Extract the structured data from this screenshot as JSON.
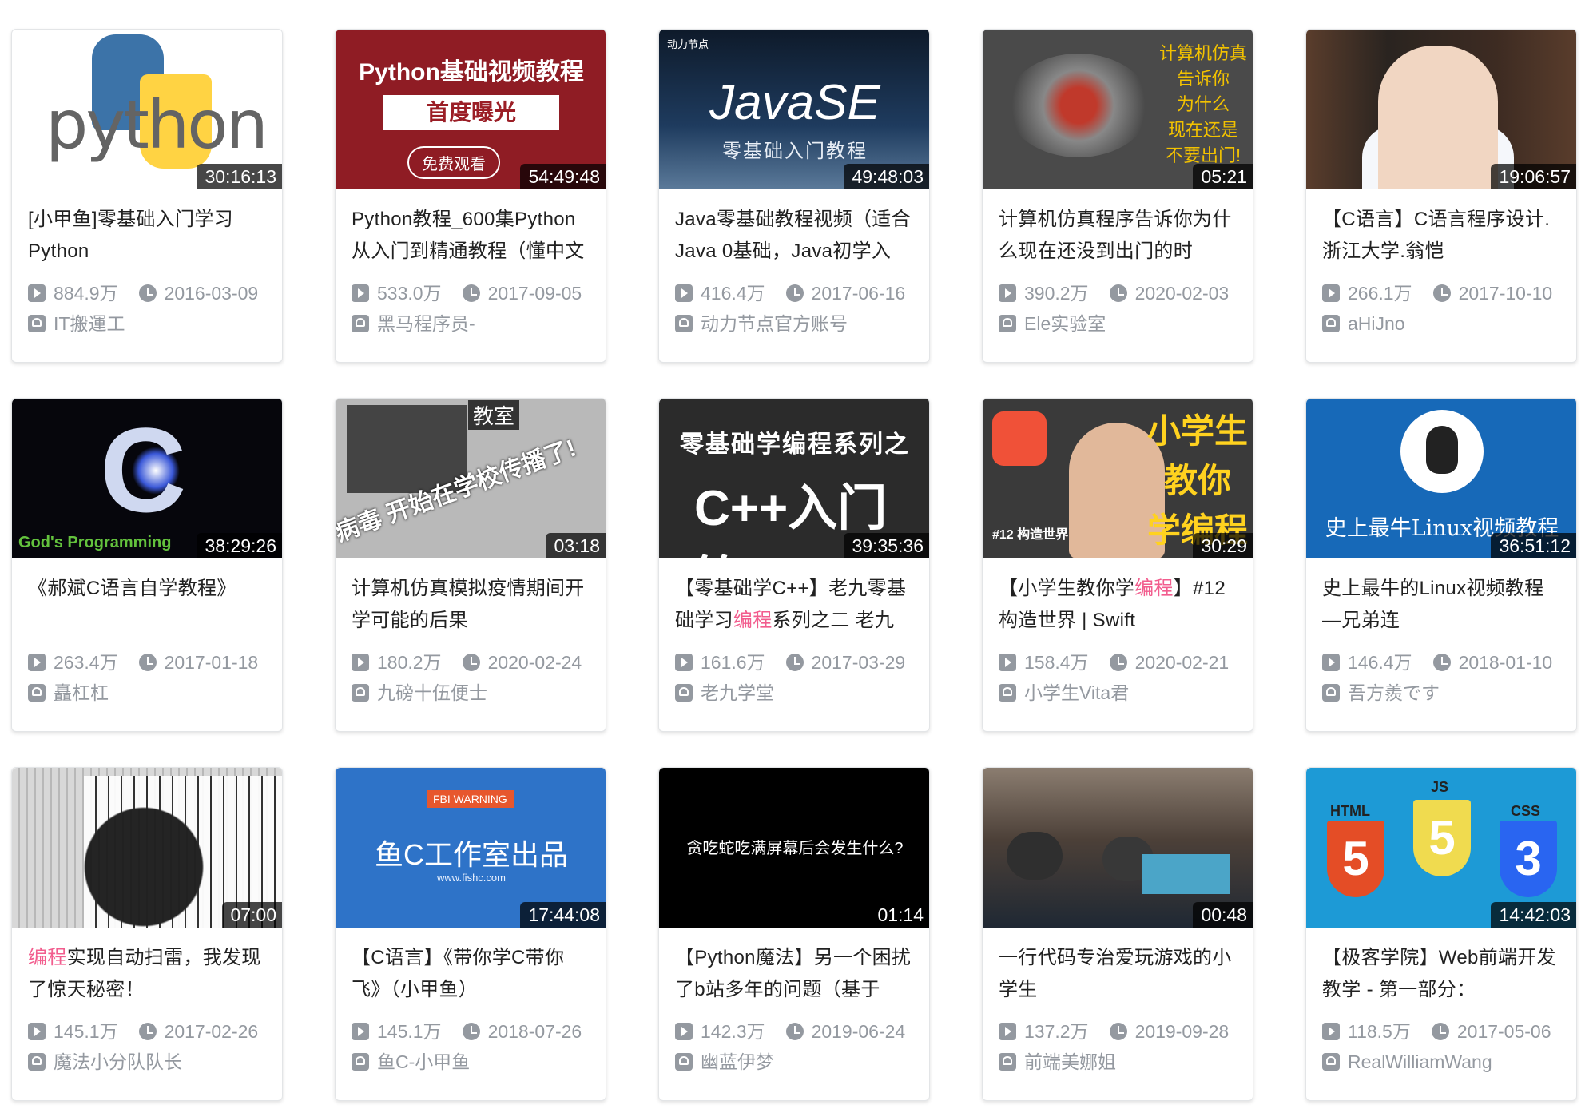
{
  "videos": [
    {
      "title": "[小甲鱼]零基础入门学习Python",
      "duration": "30:16:13",
      "views": "884.9万",
      "date": "2016-03-09",
      "author": "IT搬運工",
      "thumb": "python",
      "thumb_text": [
        "python"
      ]
    },
    {
      "title": "Python教程_600集Python从入门到精通教程（懂中文",
      "duration": "54:49:48",
      "views": "533.0万",
      "date": "2017-09-05",
      "author": "黑马程序员-",
      "thumb": "red",
      "thumb_text": [
        "Python基础视频教程",
        "首度曝光",
        "免费观看"
      ]
    },
    {
      "title": "Java零基础教程视频（适合Java 0基础，Java初学入",
      "duration": "49:48:03",
      "views": "416.4万",
      "date": "2017-06-16",
      "author": "动力节点官方账号",
      "thumb": "java",
      "thumb_text": [
        "动力节点",
        "JavaSE",
        "零基础入门教程"
      ]
    },
    {
      "title": "计算机仿真程序告诉你为什么现在还没到出门的时",
      "duration": "05:21",
      "views": "390.2万",
      "date": "2020-02-03",
      "author": "Ele实验室",
      "thumb": "sim",
      "thumb_text": [
        "计算机仿真",
        "告诉你",
        "为什么",
        "现在还是",
        "不要出门!"
      ]
    },
    {
      "title": "【C语言】C语言程序设计.浙江大学.翁恺",
      "duration": "19:06:57",
      "views": "266.1万",
      "date": "2017-10-10",
      "author": "aHiJno",
      "thumb": "lecture",
      "thumb_text": []
    },
    {
      "title": "《郝斌C语言自学教程》",
      "duration": "38:29:26",
      "views": "263.4万",
      "date": "2017-01-18",
      "author": "矗杠杠",
      "thumb": "c",
      "thumb_text": [
        "C",
        "God's Programming"
      ]
    },
    {
      "title": "计算机仿真模拟疫情期间开学可能的后果",
      "duration": "03:18",
      "views": "180.2万",
      "date": "2020-02-24",
      "author": "九磅十伍便士",
      "thumb": "virus",
      "thumb_text": [
        "教室",
        "病毒 开始在学校传播了!"
      ]
    },
    {
      "title": "【零基础学C++】老九零基础学习编程系列之二 老九学",
      "highlight": "编程",
      "duration": "39:35:36",
      "views": "161.6万",
      "date": "2017-03-29",
      "author": "老九学堂",
      "thumb": "cpp",
      "thumb_text": [
        "零基础学编程系列之",
        "C++入门篇"
      ]
    },
    {
      "title": "【小学生教你学编程】#12 构造世界 | Swift",
      "highlight": "编程",
      "duration": "30:29",
      "views": "158.4万",
      "date": "2020-02-21",
      "author": "小学生Vita君",
      "thumb": "kid",
      "thumb_text": [
        "小学生",
        "教你",
        "学编程",
        "#12 构造世界"
      ]
    },
    {
      "title": "史上最牛的Linux视频教程—兄弟连",
      "duration": "36:51:12",
      "views": "146.4万",
      "date": "2018-01-10",
      "author": "吾方羨です",
      "thumb": "linux",
      "thumb_text": [
        "史上最牛Linux视频教程"
      ]
    },
    {
      "title": "编程实现自动扫雷，我发现了惊天秘密！",
      "highlight": "编程",
      "duration": "07:00",
      "views": "145.1万",
      "date": "2017-02-26",
      "author": "魔法小分队队长",
      "thumb": "mine",
      "thumb_text": []
    },
    {
      "title": "【C语言】《带你学C带你飞》（小甲鱼）",
      "duration": "17:44:08",
      "views": "145.1万",
      "date": "2018-07-26",
      "author": "鱼C-小甲鱼",
      "thumb": "fbi",
      "thumb_text": [
        "FBI WARNING",
        "鱼C工作室出品",
        "www.fishc.com"
      ]
    },
    {
      "title": "【Python魔法】另一个困扰了b站多年的问题（基于",
      "duration": "01:14",
      "views": "142.3万",
      "date": "2019-06-24",
      "author": "幽蓝伊梦",
      "thumb": "black",
      "thumb_text": [
        "贪吃蛇吃满屏幕后会发生什么?"
      ]
    },
    {
      "title": "一行代码专治爱玩游戏的小学生",
      "duration": "00:48",
      "views": "137.2万",
      "date": "2019-09-28",
      "author": "前端美娜姐",
      "thumb": "game",
      "thumb_text": []
    },
    {
      "title": "【极客学院】Web前端开发教学 - 第一部分：",
      "duration": "14:42:03",
      "views": "118.5万",
      "date": "2017-05-06",
      "author": "RealWilliamWang",
      "thumb": "web",
      "thumb_text": [
        "HTML",
        "JS",
        "CSS"
      ]
    }
  ],
  "icons": {
    "views": "play-count-icon",
    "date": "clock-icon",
    "author": "uploader-icon"
  },
  "colors": {
    "highlight": "#f25d8e",
    "meta": "#9499a0",
    "title": "#212121"
  }
}
